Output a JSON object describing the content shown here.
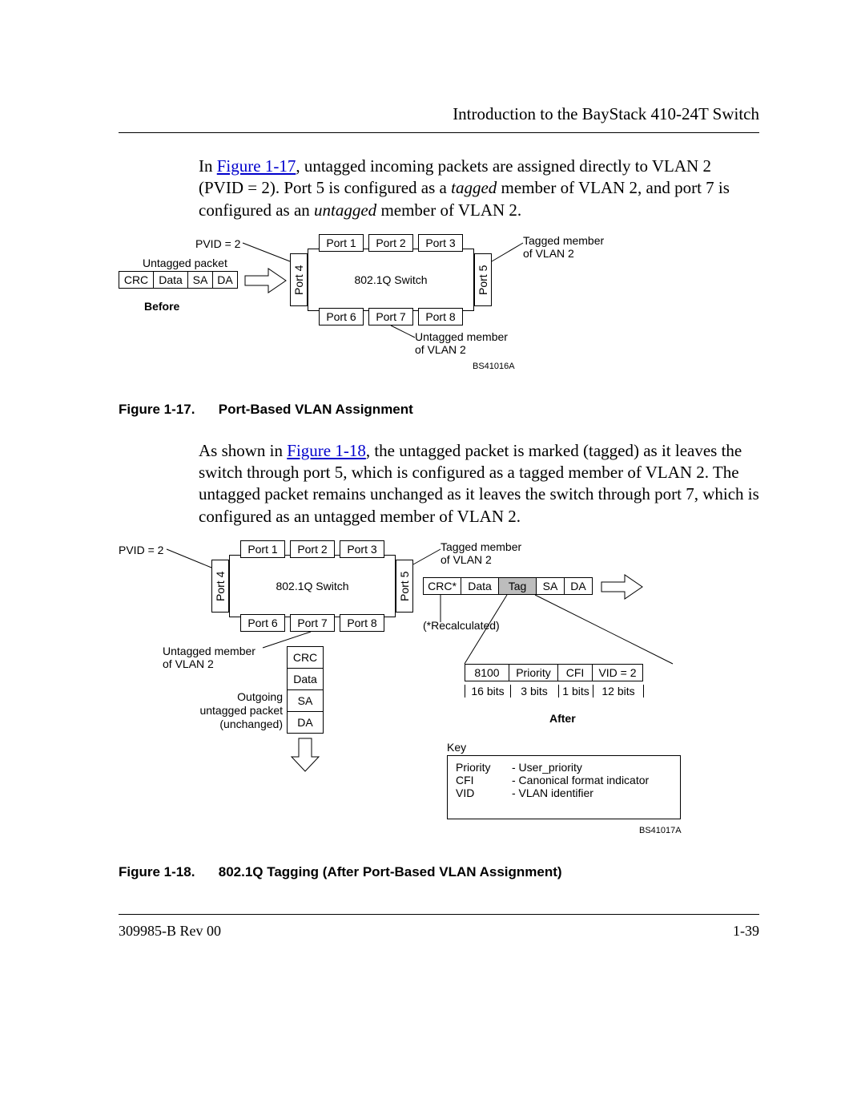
{
  "header": {
    "title": "Introduction to the BayStack 410-24T Switch"
  },
  "para1": {
    "pre": "In ",
    "link": "Figure 1-17",
    "mid1": ", untagged incoming packets are assigned directly to VLAN 2 (PVID = 2). Port 5 is configured as a ",
    "tagged": "tagged",
    "mid2": " member of VLAN 2, and port 7 is configured as an ",
    "untagged": "untagged",
    "mid3": " member of VLAN 2."
  },
  "fig17": {
    "pvid": "PVID = 2",
    "untagged_packet": "Untagged packet",
    "pkt": {
      "crc": "CRC",
      "data": "Data",
      "sa": "SA",
      "da": "DA"
    },
    "before": "Before",
    "port4": "Port 4",
    "port5": "Port 5",
    "switch": "802.1Q Switch",
    "ports_top": [
      "Port 1",
      "Port 2",
      "Port 3"
    ],
    "ports_bot": [
      "Port 6",
      "Port 7",
      "Port 8"
    ],
    "tagged_member": "Tagged member\nof VLAN 2",
    "untagged_member": "Untagged member\nof VLAN 2",
    "code": "BS41016A",
    "caption_num": "Figure 1-17.",
    "caption_txt": "Port-Based VLAN Assignment"
  },
  "para2": {
    "pre": "As shown in ",
    "link": "Figure 1-18",
    "post": ", the untagged packet is marked (tagged) as it leaves the switch through port 5, which is configured as a tagged member of VLAN 2. The untagged packet remains unchanged as it leaves the switch through port 7, which is configured as an untagged member of VLAN 2."
  },
  "fig18": {
    "pvid": "PVID = 2",
    "port4": "Port 4",
    "port5": "Port 5",
    "switch": "802.1Q Switch",
    "ports_top": [
      "Port 1",
      "Port 2",
      "Port 3"
    ],
    "ports_bot": [
      "Port 6",
      "Port 7",
      "Port 8"
    ],
    "tagged_member": "Tagged member\nof VLAN 2",
    "untagged_member": "Untagged member\nof VLAN 2",
    "recalc": "(*Recalculated)",
    "tagged_pkt": {
      "crc": "CRC*",
      "data": "Data",
      "tag": "Tag",
      "sa": "SA",
      "da": "DA"
    },
    "vpkt": {
      "crc": "CRC",
      "data": "Data",
      "sa": "SA",
      "da": "DA"
    },
    "outgoing1": "Outgoing",
    "outgoing2": "untagged packet",
    "outgoing3": "(unchanged)",
    "tag_fields": {
      "f1": "8100",
      "f2": "Priority",
      "f3": "CFI",
      "f4": "VID = 2"
    },
    "tag_bits": {
      "b1": "16 bits",
      "b2": "3 bits",
      "b3": "1 bits",
      "b4": "12 bits"
    },
    "after": "After",
    "key_title": "Key",
    "key": {
      "k1": "Priority",
      "v1": "- User_priority",
      "k2": "CFI",
      "v2": "- Canonical format indicator",
      "k3": "VID",
      "v3": "- VLAN identifier"
    },
    "code": "BS41017A",
    "caption_num": "Figure 1-18.",
    "caption_txt": "802.1Q Tagging (After Port-Based VLAN Assignment)"
  },
  "footer": {
    "left": "309985-B Rev 00",
    "right": "1-39"
  }
}
